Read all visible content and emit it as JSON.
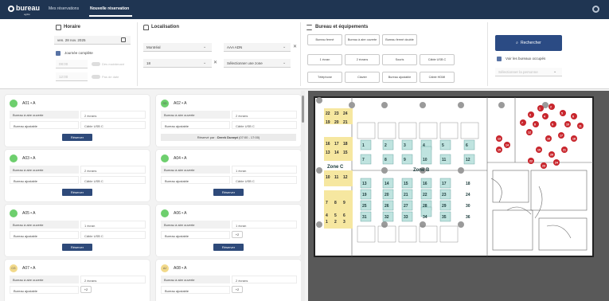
{
  "app": {
    "logo_text": "bureau",
    "logo_sub": "agilité"
  },
  "nav": {
    "my_reservations": "Mes réservations",
    "new_reservation": "Nouvelle réservation"
  },
  "schedule": {
    "title": "Horaire",
    "date": "ven. 28 nov. 2025",
    "full_day_label": "Journée complète",
    "start_time": "08:00",
    "end_time": "12:00",
    "book_now_label": "Dès maintenant",
    "all_day_label": "Pas de date"
  },
  "location": {
    "title": "Localisation",
    "city": "Montréal",
    "building": "AAA ADN",
    "floor": "18",
    "zone_placeholder": "Sélectionner une zone"
  },
  "equipment": {
    "title": "Bureau et équipements",
    "desk_types": [
      "Bureau fermé",
      "Bureau à aire ouverte",
      "Bureau fermé double"
    ],
    "items_row1": [
      "1 écran",
      "2 écrans",
      "Souris",
      "Câble USB C"
    ],
    "items_row2": [
      "Téléphone",
      "Clavier",
      "Bureau ajustable",
      "Câble HDMI"
    ]
  },
  "search": {
    "button_label": "Rechercher",
    "show_occupied_label": "Voir les bureaux occupés",
    "person_placeholder": "Sélectionner la personne"
  },
  "cards": [
    {
      "name": "A01 • A",
      "status": "green",
      "badge": "",
      "type": "Bureau à aire ouverte",
      "screens": "2 écrans",
      "adjustable": "Bureau ajustable",
      "extra": "Câble USB C",
      "action": "Réserver"
    },
    {
      "name": "A02 • A",
      "status": "green",
      "badge": "DD",
      "type": "Bureau à aire ouverte",
      "screens": "2 écrans",
      "adjustable": "Bureau ajustable",
      "extra": "Câble USB C",
      "reserved_prefix": "Réservé par :",
      "reserved_by": "Derek Dunept",
      "reserved_time": "(07:00 - 17:00)"
    },
    {
      "name": "A03 • A",
      "status": "green",
      "badge": "",
      "type": "Bureau à aire ouverte",
      "screens": "2 écrans",
      "adjustable": "Bureau ajustable",
      "extra": "Câble USB C",
      "action": "Réserver"
    },
    {
      "name": "A04 • A",
      "status": "green",
      "badge": "",
      "type": "Bureau à aire ouverte",
      "screens": "1 écran",
      "adjustable": "Bureau ajustable",
      "extra": "Câble USB C",
      "action": "Réserver"
    },
    {
      "name": "A05 • A",
      "status": "green",
      "badge": "",
      "type": "Bureau à aire ouverte",
      "screens": "1 écran",
      "adjustable": "Bureau ajustable",
      "extra": "Câble USB C",
      "action": "Réserver"
    },
    {
      "name": "A06 • A",
      "status": "green",
      "badge": "",
      "type": "Bureau à aire ouverte",
      "screens": "1 écran",
      "adjustable": "Bureau ajustable",
      "extra": "+2",
      "action": "Réserver"
    },
    {
      "name": "A07 • A",
      "status": "yellow",
      "badge": "CG",
      "type": "Bureau à aire ouverte",
      "screens": "2 écrans",
      "adjustable": "Bureau ajustable",
      "extra": "+2"
    },
    {
      "name": "A08 • A",
      "status": "yellow",
      "badge": "AJ",
      "type": "Bureau à aire ouverte",
      "screens": "2 écrans",
      "adjustable": "Bureau ajustable",
      "extra": "+2"
    }
  ],
  "map": {
    "zone_b": "Zone B",
    "zone_c": "Zone C",
    "zone_c_desks": [
      "22",
      "23",
      "24",
      "19",
      "20",
      "21",
      "16",
      "17",
      "18",
      "13",
      "14",
      "15",
      "10",
      "11",
      "12",
      "7",
      "8",
      "9",
      "4",
      "5",
      "6",
      "1",
      "2",
      "3"
    ],
    "zone_b_desks": [
      "1",
      "2",
      "3",
      "4",
      "5",
      "6",
      "7",
      "8",
      "9",
      "10",
      "11",
      "12",
      "13",
      "14",
      "15",
      "16",
      "17",
      "18",
      "19",
      "20",
      "21",
      "22",
      "23",
      "24",
      "25",
      "26",
      "27",
      "28",
      "29",
      "30",
      "31",
      "32",
      "33",
      "34",
      "35",
      "36"
    ],
    "zone_a_desks": [
      "1",
      "2",
      "3",
      "4",
      "5",
      "6",
      "7",
      "8",
      "9",
      "10",
      "11",
      "12",
      "13",
      "14",
      "15",
      "16",
      "17",
      "18",
      "19",
      "20",
      "21",
      "22",
      "23",
      "24"
    ]
  },
  "colors": {
    "nav_bg": "#1f3552",
    "primary": "#2b4b84",
    "available": "#6ecf6e",
    "partial": "#f2d98a",
    "occupied": "#c8252c",
    "zone_c_highlight": "#f6e7a0",
    "zone_b_highlight": "#bfe3df"
  }
}
